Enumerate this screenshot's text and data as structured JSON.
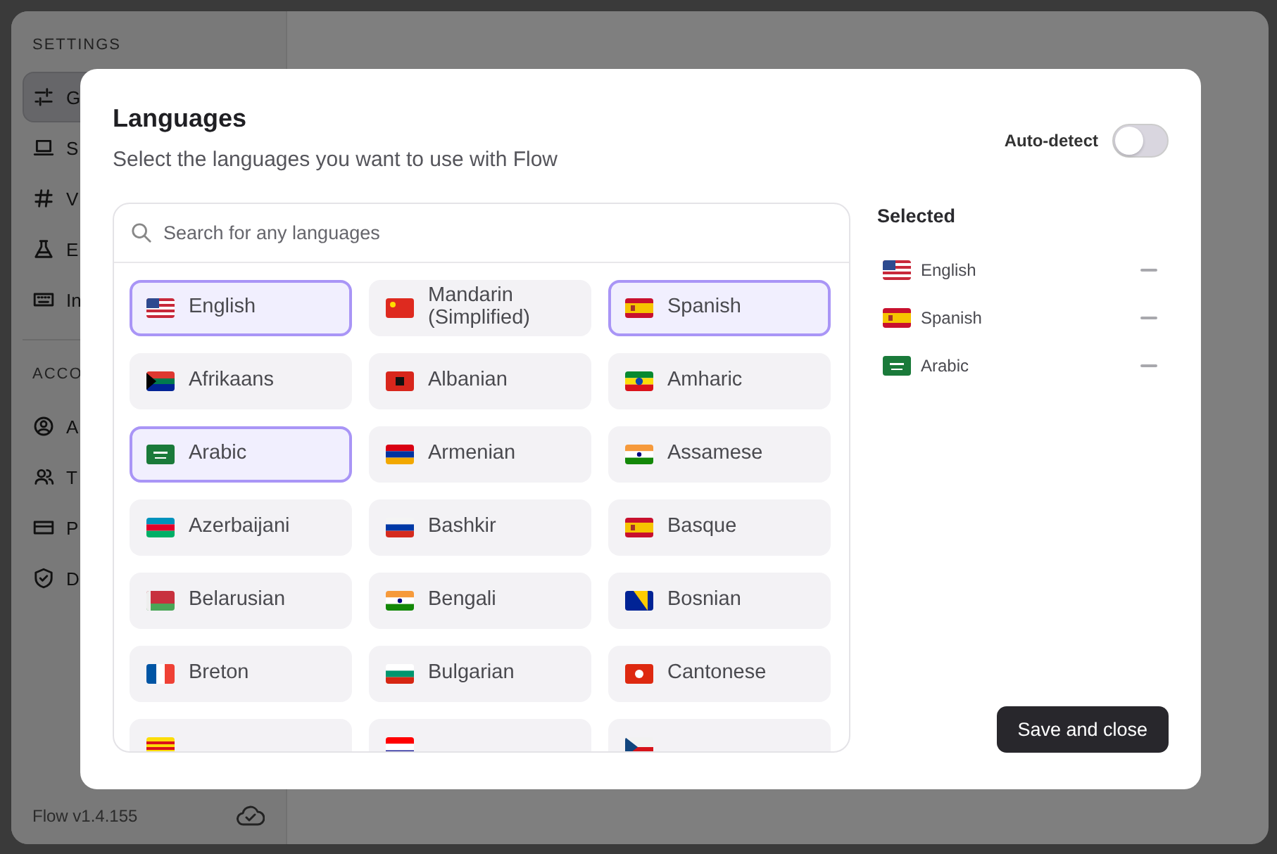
{
  "sidebar": {
    "section_title": "SETTINGS",
    "items": [
      {
        "label": "G",
        "selected": true
      },
      {
        "label": "S",
        "selected": false
      },
      {
        "label": "V",
        "selected": false
      },
      {
        "label": "E",
        "selected": false
      },
      {
        "label": "In",
        "selected": false
      }
    ],
    "account_title": "ACCO",
    "account_items": [
      {
        "label": "A",
        "selected": false
      },
      {
        "label": "T",
        "selected": false
      },
      {
        "label": "P",
        "selected": false
      },
      {
        "label": "D",
        "selected": false
      }
    ],
    "version": "Flow v1.4.155"
  },
  "dialog": {
    "title": "Languages",
    "subtitle": "Select the languages you want to use with Flow",
    "auto_detect": {
      "label": "Auto-detect",
      "on": false
    },
    "search": {
      "placeholder": "Search for any languages"
    },
    "languages": [
      {
        "kind": "language",
        "label": "English",
        "selected": true
      },
      {
        "kind": "language",
        "label": "Mandarin (Simplified)",
        "selected": false
      },
      {
        "kind": "language",
        "label": "Spanish",
        "selected": true
      },
      {
        "kind": "language",
        "label": "Afrikaans",
        "selected": false
      },
      {
        "kind": "language",
        "label": "Albanian",
        "selected": false
      },
      {
        "kind": "language",
        "label": "Amharic",
        "selected": false
      },
      {
        "kind": "language",
        "label": "Arabic",
        "selected": true
      },
      {
        "kind": "language",
        "label": "Armenian",
        "selected": false
      },
      {
        "kind": "language",
        "label": "Assamese",
        "selected": false
      },
      {
        "kind": "language",
        "label": "Azerbaijani",
        "selected": false
      },
      {
        "kind": "language",
        "label": "Bashkir",
        "selected": false
      },
      {
        "kind": "language",
        "label": "Basque",
        "selected": false
      },
      {
        "kind": "language",
        "label": "Belarusian",
        "selected": false
      },
      {
        "kind": "language",
        "label": "Bengali",
        "selected": false
      },
      {
        "kind": "language",
        "label": "Bosnian",
        "selected": false
      },
      {
        "kind": "language",
        "label": "Breton",
        "selected": false
      },
      {
        "kind": "language",
        "label": "Bulgarian",
        "selected": false
      },
      {
        "kind": "language",
        "label": "Cantonese",
        "selected": false
      },
      {
        "kind": "cut",
        "selected": false
      },
      {
        "kind": "cut",
        "selected": false
      },
      {
        "kind": "cut",
        "selected": false
      }
    ],
    "selected_title": "Selected",
    "selected_list": [
      {
        "label": "English"
      },
      {
        "label": "Spanish"
      },
      {
        "label": "Arabic"
      }
    ],
    "save_button": "Save and close"
  }
}
